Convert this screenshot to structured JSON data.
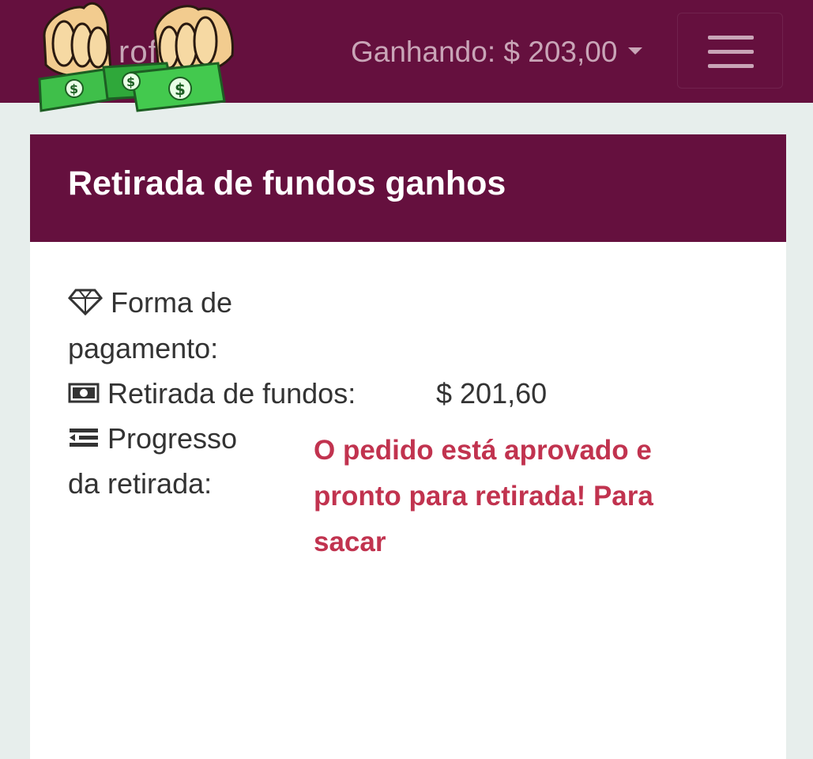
{
  "header": {
    "brand_text": "rofitxyz",
    "balance_label": "Ganhando: $ 203,00"
  },
  "card": {
    "title": "Retirada de fundos ganhos",
    "payment_method": {
      "label_line1": "Forma de",
      "label_line2": "pagamento:",
      "icon": "diamond-icon"
    },
    "withdrawal": {
      "label": "Retirada de fundos:",
      "value": "$ 201,60",
      "icon": "money-icon"
    },
    "progress": {
      "label_line1": "Progresso",
      "label_line2": "da retirada:",
      "icon": "list-icon",
      "status_text": "O pedido está aprovado e pronto para retirada! Para sacar"
    }
  },
  "colors": {
    "brand": "#65103e",
    "status": "#c1334f",
    "background": "#e7eeec"
  }
}
